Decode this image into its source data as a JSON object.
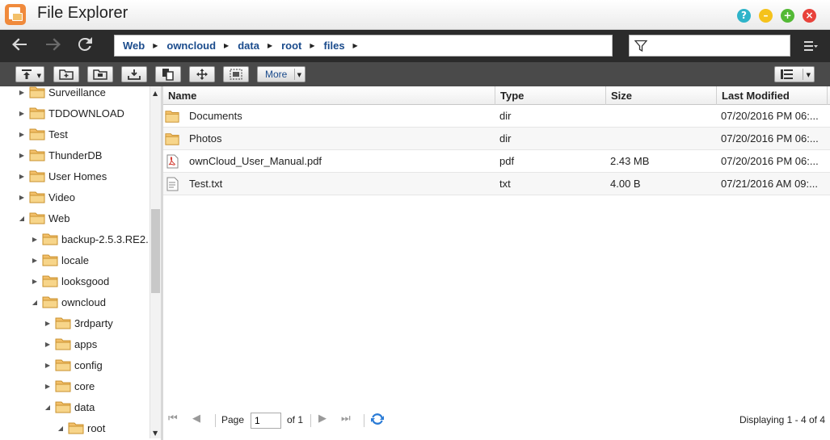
{
  "window": {
    "title": "File Explorer",
    "controls": {
      "help": "?",
      "minimize": "–",
      "maximize": "+",
      "close": "×"
    }
  },
  "nav": {
    "breadcrumb": [
      "Web",
      "owncloud",
      "data",
      "root",
      "files"
    ],
    "filter_value": ""
  },
  "toolbar": {
    "more_label": "More"
  },
  "tree": {
    "items": [
      {
        "label": "Surveillance",
        "arrow": "▶"
      },
      {
        "label": "TDDOWNLOAD",
        "arrow": "▶"
      },
      {
        "label": "Test",
        "arrow": "▶"
      },
      {
        "label": "ThunderDB",
        "arrow": "▶"
      },
      {
        "label": "User Homes",
        "arrow": "▶"
      },
      {
        "label": "Video",
        "arrow": "▶"
      },
      {
        "label": "Web",
        "arrow": "◢"
      },
      {
        "label": "backup-2.5.3.RE2.",
        "arrow": "▶"
      },
      {
        "label": "locale",
        "arrow": "▶"
      },
      {
        "label": "looksgood",
        "arrow": "▶"
      },
      {
        "label": "owncloud",
        "arrow": "◢"
      },
      {
        "label": "3rdparty",
        "arrow": "▶"
      },
      {
        "label": "apps",
        "arrow": "▶"
      },
      {
        "label": "config",
        "arrow": "▶"
      },
      {
        "label": "core",
        "arrow": "▶"
      },
      {
        "label": "data",
        "arrow": "◢"
      },
      {
        "label": "root",
        "arrow": "◢"
      }
    ]
  },
  "grid": {
    "columns": [
      "Name",
      "Type",
      "Size",
      "Last Modified"
    ],
    "rows": [
      {
        "name": "Documents",
        "type": "dir",
        "size": "",
        "modified": "07/20/2016 PM 06:...",
        "icon": "folder"
      },
      {
        "name": "Photos",
        "type": "dir",
        "size": "",
        "modified": "07/20/2016 PM 06:...",
        "icon": "folder"
      },
      {
        "name": "ownCloud_User_Manual.pdf",
        "type": "pdf",
        "size": "2.43 MB",
        "modified": "07/20/2016 PM 06:...",
        "icon": "pdf"
      },
      {
        "name": "Test.txt",
        "type": "txt",
        "size": "4.00 B",
        "modified": "07/21/2016 AM 09:...",
        "icon": "txt"
      }
    ]
  },
  "pager": {
    "page_label": "Page",
    "page_value": "1",
    "of_label": "of 1",
    "display_text": "Displaying 1 - 4 of 4"
  },
  "colors": {
    "accent": "#1a4b8c",
    "folder": "#f3c06a",
    "titlebar_dark": "#2b2b2b",
    "toolbar": "#4a4a4a"
  }
}
